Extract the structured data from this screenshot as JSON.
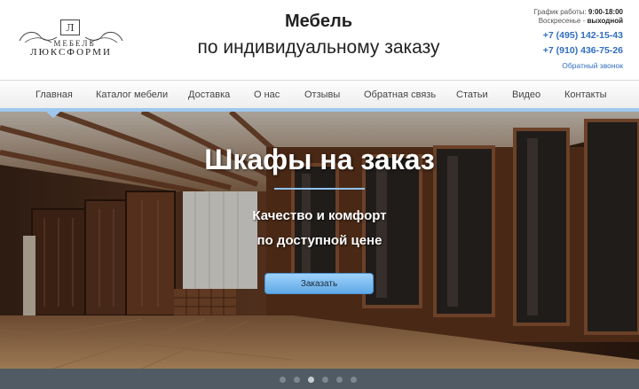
{
  "logo": {
    "emblem": "Л",
    "top": "МЕБЕЛЬ",
    "bottom": "ЛЮКСФОРМИ"
  },
  "header": {
    "title_line1": "Мебель",
    "title_line2": "по индивидуальному заказу"
  },
  "contacts": {
    "hours_label": "График работы:",
    "hours_value": "9:00-18:00",
    "weekend_label": "Воскресенье -",
    "weekend_value": "выходной",
    "phone1": "+7 (495) 142-15-43",
    "phone2": "+7 (910) 436-75-26",
    "callback": "Обратный звонок"
  },
  "nav": {
    "items": [
      {
        "label": "Главная"
      },
      {
        "label": "Каталог мебели"
      },
      {
        "label": "Доставка"
      },
      {
        "label": "О нас"
      },
      {
        "label": "Отзывы"
      },
      {
        "label": "Обратная связь"
      },
      {
        "label": "Статьи"
      },
      {
        "label": "Видео"
      },
      {
        "label": "Контакты"
      }
    ],
    "active_index": 0
  },
  "hero": {
    "title": "Шкафы на заказ",
    "subtitle_line1": "Качество и комфорт",
    "subtitle_line2": "по доступной цене",
    "button_label": "Заказать"
  },
  "slider": {
    "count": 6,
    "active_index": 2
  },
  "colors": {
    "accent": "#2f6ebf",
    "nav_bar": "#9ec7ee",
    "button": "#6fb3ea",
    "dots_bg": "#515b63"
  }
}
